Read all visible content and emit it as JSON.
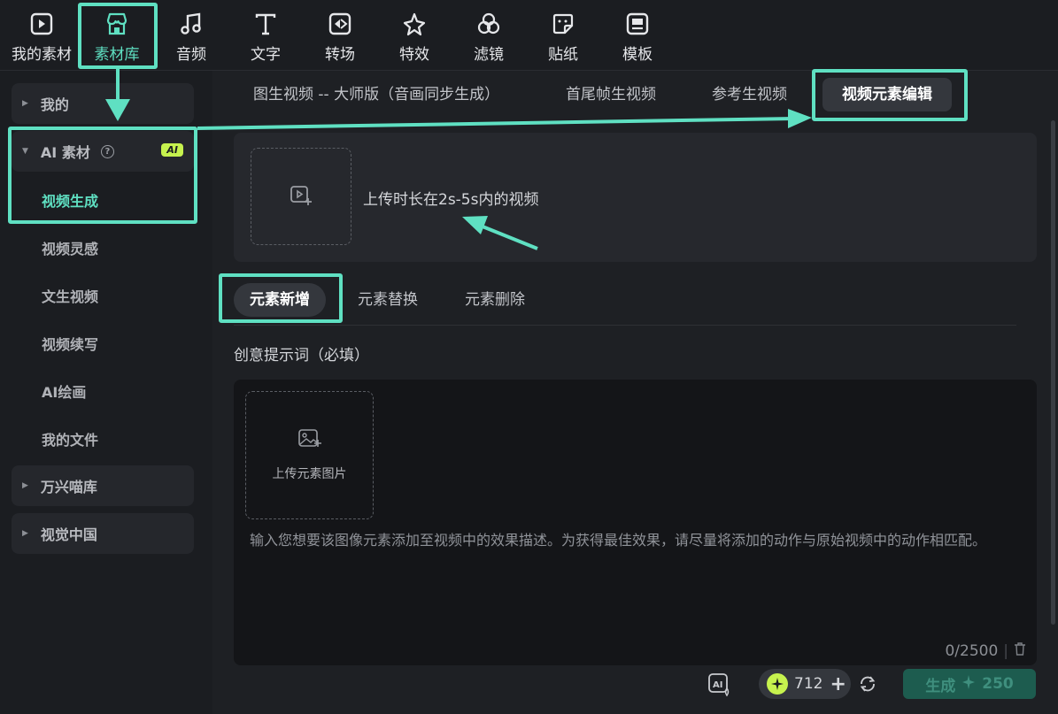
{
  "toolbar": {
    "items": [
      {
        "label": "我的素材",
        "icon": "my-media-icon"
      },
      {
        "label": "素材库",
        "icon": "store-icon"
      },
      {
        "label": "音频",
        "icon": "music-note-icon"
      },
      {
        "label": "文字",
        "icon": "text-t-icon"
      },
      {
        "label": "转场",
        "icon": "transition-icon"
      },
      {
        "label": "特效",
        "icon": "sparkle-icon"
      },
      {
        "label": "滤镜",
        "icon": "filter-icon"
      },
      {
        "label": "贴纸",
        "icon": "sticker-icon"
      },
      {
        "label": "模板",
        "icon": "template-icon"
      }
    ],
    "active_index": 1
  },
  "sidebar": {
    "groups": [
      {
        "label": "我的"
      },
      {
        "label": "AI 素材",
        "badge": "AI",
        "help": "?"
      },
      {
        "label": "万兴喵库"
      },
      {
        "label": "视觉中国"
      }
    ],
    "items": [
      {
        "label": "视频生成",
        "active": true
      },
      {
        "label": "视频灵感"
      },
      {
        "label": "文生视频"
      },
      {
        "label": "视频续写"
      },
      {
        "label": "AI绘画"
      },
      {
        "label": "我的文件"
      }
    ]
  },
  "main": {
    "tabs": [
      {
        "label": "图生视频 -- 大师版（音画同步生成）"
      },
      {
        "label": "首尾帧生视频"
      },
      {
        "label": "参考生视频"
      },
      {
        "label": "视频元素编辑",
        "active": true
      }
    ],
    "upload_video_hint": "上传时长在2s-5s内的视频",
    "sub_tabs": [
      {
        "label": "元素新增",
        "active": true
      },
      {
        "label": "元素替换"
      },
      {
        "label": "元素删除"
      }
    ],
    "prompt_label": "创意提示词（必填）",
    "upload_image_label": "上传元素图片",
    "prompt_placeholder": "输入您想要该图像元素添加至视频中的效果描述。为获得最佳效果，请尽量将添加的动作与原始视频中的动作相匹配。",
    "char_count": "0/2500",
    "separator": "|"
  },
  "footer": {
    "credits": "712",
    "plus": "+",
    "generate_label": "生成",
    "generate_cost": "250"
  },
  "colors": {
    "accent": "#5fe0c2",
    "badge": "#c6f24e",
    "background": "#1b1d21",
    "panel": "#26282d"
  }
}
